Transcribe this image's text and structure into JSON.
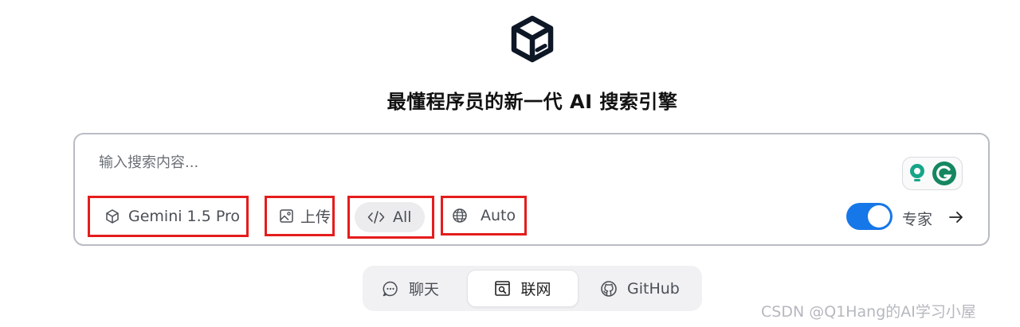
{
  "header": {
    "logo_icon": "cube-logo-icon",
    "tagline": "最懂程序员的新一代 AI 搜索引擎"
  },
  "search": {
    "placeholder": "输入搜索内容...",
    "value": ""
  },
  "extensions": {
    "icons": [
      "bulb-extension-icon",
      "grammarly-icon"
    ]
  },
  "options": {
    "model": {
      "label": "Gemini 1.5 Pro",
      "icon": "cube-icon"
    },
    "upload": {
      "label": "上传",
      "icon": "image-icon"
    },
    "scope": {
      "label": "All",
      "icon": "code-icon"
    },
    "language": {
      "label": "Auto",
      "icon": "globe-icon"
    }
  },
  "expert": {
    "label": "专家",
    "enabled": true
  },
  "submit": {
    "icon": "arrow-right-icon"
  },
  "mode_tabs": [
    {
      "label": "聊天",
      "icon": "chat-icon",
      "active": false
    },
    {
      "label": "联网",
      "icon": "web-search-icon",
      "active": true
    },
    {
      "label": "GitHub",
      "icon": "github-icon",
      "active": false
    }
  ],
  "watermark": "CSDN @Q1Hang的AI学习小屋",
  "colors": {
    "accent": "#1677e8",
    "highlight_border": "#e51c1c",
    "tab_bg": "#f1f1f3"
  }
}
